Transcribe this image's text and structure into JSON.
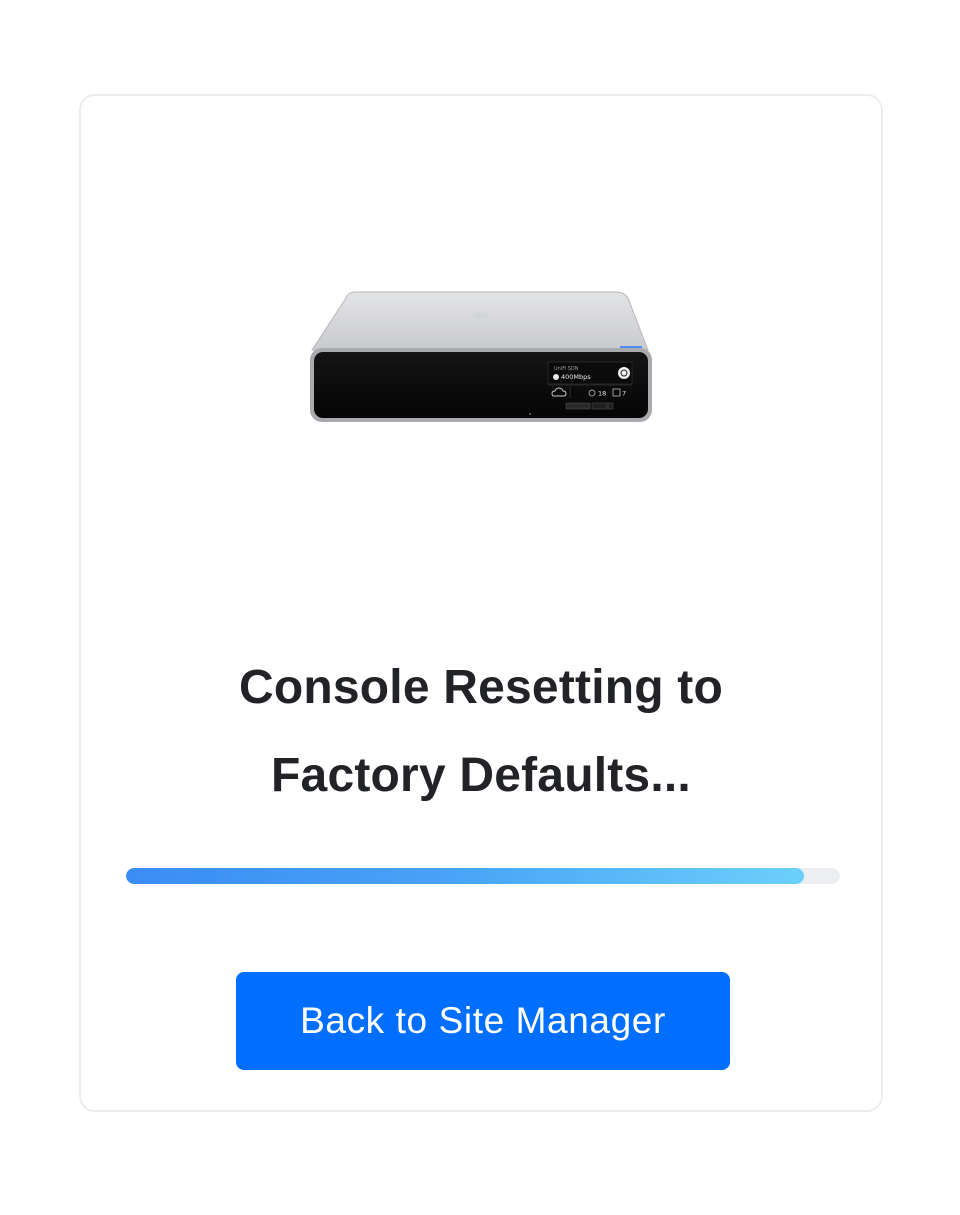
{
  "device": {
    "icon": "console-device-image",
    "screen_label": "UniFi SDN",
    "screen_speed": "400Mbps",
    "screen_count_a": "18",
    "screen_count_b": "7"
  },
  "status": {
    "title_line1": "Console Resetting to",
    "title_line2": "Factory Defaults...",
    "progress_percent": 95
  },
  "actions": {
    "back_label": "Back to Site Manager"
  },
  "colors": {
    "accent": "#006fff",
    "progress_start": "#3b8cf4",
    "progress_end": "#6cd0fb",
    "progress_track": "#eceef1",
    "title_text": "#212327",
    "card_border": "#ebedf0"
  }
}
